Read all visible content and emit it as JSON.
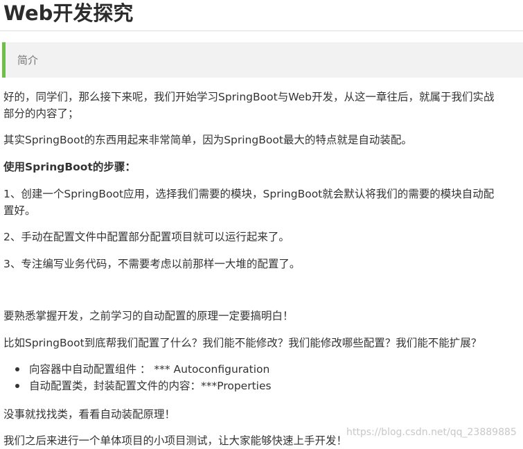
{
  "title": "Web开发探究",
  "intro_label": "简介",
  "paragraphs": {
    "p1_line1": "好的，同学们，那么接下来呢，我们开始学习SpringBoot与Web开发，从这一章往后，就属于我们实战",
    "p1_line2": "部分的内容了；",
    "p2": "其实SpringBoot的东西用起来非常简单，因为SpringBoot最大的特点就是自动装配。",
    "steps_heading": "使用SpringBoot的步骤：",
    "step1_line1": "1、创建一个SpringBoot应用，选择我们需要的模块，SpringBoot就会默认将我们的需要的模块自动配",
    "step1_line2": "置好。",
    "step2": "2、手动在配置文件中配置部分配置项目就可以运行起来了。",
    "step3": "3、专注编写业务代码，不需要考虑以前那样一大堆的配置了。",
    "p3": "要熟悉掌握开发，之前学习的自动配置的原理一定要搞明白！",
    "p4": "比如SpringBoot到底帮我们配置了什么？我们能不能修改？我们能修改哪些配置？我们能不能扩展？",
    "p5": "没事就找找类，看看自动装配原理！",
    "p6": "我们之后来进行一个单体项目的小项目测试，让大家能够快速上手开发！"
  },
  "bullets": [
    "向容器中自动配置组件 ： *** Autoconfiguration",
    "自动配置类，封装配置文件的内容：***Properties"
  ],
  "watermark": "https://blog.csdn.net/qq_23889885",
  "colors": {
    "accent_bar": "#6fbf49",
    "intro_bg": "#f2f2f2",
    "text": "#333333"
  }
}
